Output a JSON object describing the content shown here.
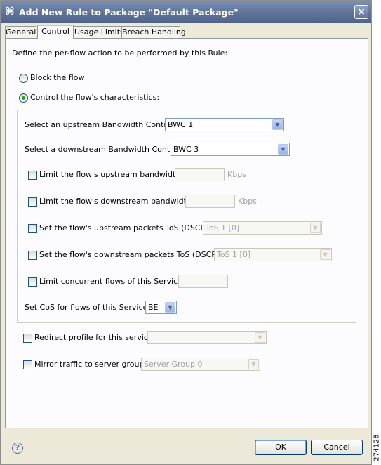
{
  "window": {
    "title": "Add New Rule to Package \"Default Package\"",
    "icon": "app-icon",
    "close_icon": "×"
  },
  "tabs": [
    {
      "label": "General",
      "active": false
    },
    {
      "label": "Control",
      "active": true
    },
    {
      "label": "Usage Limits",
      "active": false
    },
    {
      "label": "Breach Handling",
      "active": false
    }
  ],
  "control": {
    "intro": "Define the per-flow action to be performed by this Rule:",
    "radio_block": {
      "label": "Block the flow",
      "selected": false
    },
    "radio_control": {
      "label": "Control the flow's characteristics:",
      "selected": true
    },
    "upstream_bwc": {
      "label": "Select an upstream Bandwidth Controller",
      "value": "BWC 1"
    },
    "downstream_bwc": {
      "label": "Select a downstream Bandwidth Controller",
      "value": "BWC 3"
    },
    "limit_up": {
      "label": "Limit the flow's upstream bandwidth to",
      "value": "",
      "unit": "Kbps",
      "checked": false
    },
    "limit_down": {
      "label": "Limit the flow's downstream bandwidth to",
      "value": "",
      "unit": "Kbps",
      "checked": false
    },
    "tos_up": {
      "label": "Set the flow's upstream packets ToS (DSCP) to",
      "value": "ToS 1 [0]",
      "checked": false
    },
    "tos_down": {
      "label": "Set the flow's downstream packets ToS (DSCP) to",
      "value": "ToS 1 [0]",
      "checked": false
    },
    "concurrent": {
      "label": "Limit concurrent flows of this Service to",
      "value": "",
      "checked": false
    },
    "cos": {
      "label": "Set CoS for flows of this Service to",
      "value": "BE"
    },
    "redirect": {
      "label": "Redirect profile for this service:",
      "value": "",
      "checked": false
    },
    "mirror": {
      "label": "Mirror traffic to server group:",
      "value": "Server Group 0",
      "checked": false
    }
  },
  "footer": {
    "help_icon": "?",
    "ok_label": "OK",
    "cancel_label": "Cancel"
  },
  "side_id": "274128",
  "colors": {
    "titlebar": "#5e7397",
    "dialog_bg": "#ece9d8",
    "panel_bg": "#fcfcfe",
    "tab_highlight": "#ffc83c",
    "radio_dot": "#21a121",
    "control_border": "#1c5180"
  }
}
